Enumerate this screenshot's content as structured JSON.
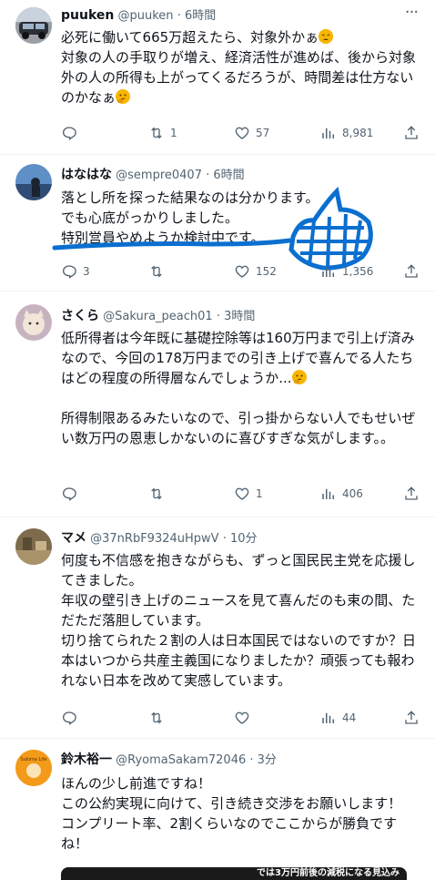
{
  "posts": [
    {
      "name": "puuken",
      "handle": "@puuken",
      "time": "· 6時間",
      "text": "必死に働いて665万超えたら、対象外かぁ",
      "text2": "対象の人の手取りが増え、経済活性が進めば、後から対象外の人の所得も上がってくるだろうが、時間差は仕方ないのかなぁ",
      "replies": "",
      "reposts": "1",
      "likes": "57",
      "views": "8,981",
      "emoji1": "weary-face",
      "emoji2": "thinking-face"
    },
    {
      "name": "はなはな",
      "handle": "@sempre0407",
      "time": "· 6時間",
      "text": "落とし所を探った結果なのは分かります。\nでも心底がっかりしました。\n特別営員やめようか検討中です。",
      "replies": "3",
      "reposts": "",
      "likes": "152",
      "views": "1,356",
      "scribble_color": "#0a6fd0"
    },
    {
      "name": "さくら",
      "handle": "@Sakura_peach01",
      "time": "· 3時間",
      "text": "低所得者は今年既に基礎控除等は160万円まで引上げ済みなので、今回の178万円までの引き上げで喜んでる人たちはどの程度の所得層なんでしょうか...",
      "text2": "所得制限あるみたいなので、引っ掛からない人でもせいぜい数万円の恩恵しかないのに喜びすぎな気がします。。",
      "replies": "",
      "reposts": "",
      "likes": "1",
      "views": "406"
    },
    {
      "name": "マメ",
      "handle": "@37nRbF9324uHpwV",
      "time": "· 10分",
      "text": "何度も不信感を抱きながらも、ずっと国民民主党を応援してきました。\n年収の壁引き上げのニュースを見て喜んだのも束の間、ただただ落胆しています。\n切り捨てられた２割の人は日本国民ではないのですか？日本はいつから共産主義国になりましたか？頑張っても報われない日本を改めて実感しています。",
      "replies": "",
      "reposts": "",
      "likes": "",
      "views": "44"
    },
    {
      "name": "鈴木裕一",
      "handle": "@RyomaSakam72046",
      "time": "· 3分",
      "text": "ほんの少し前進ですね！\nこの公約実現に向けて、引き続き交渉をお願いします！\nコンプリート率、2割くらいなのでここからが勝負ですね！",
      "avatar_label": "Sukima Life"
    }
  ],
  "bottom_card_text": "では3万円前後の減税になる見込み",
  "accent_color": "#1d9bf0"
}
